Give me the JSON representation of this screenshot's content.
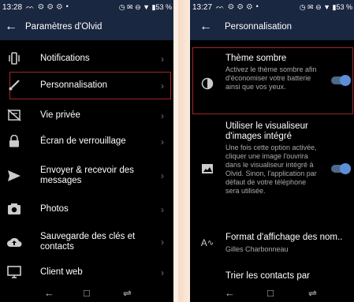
{
  "left_screen": {
    "status": {
      "time": "13:28",
      "left_icons": "ᨓ ⚙ ⚙ ⚙ •",
      "right_icons": "◷ ✉ ⊖ ▼ ▮53 %"
    },
    "appbar": {
      "back": "←",
      "title": "Paramètres d'Olvid"
    },
    "items": [
      {
        "label": "Notifications",
        "icon": "vibration-icon"
      },
      {
        "label": "Personnalisation",
        "icon": "brush-icon"
      },
      {
        "label": "Vie privée",
        "icon": "eye-off-icon"
      },
      {
        "label": "Écran de verrouillage",
        "icon": "lock-icon"
      },
      {
        "label": "Envoyer & recevoir des messages",
        "icon": "send-icon"
      },
      {
        "label": "Photos",
        "icon": "camera-icon"
      },
      {
        "label": "Sauvegarde des clés et contacts",
        "icon": "cloud-upload-icon"
      },
      {
        "label": "Client web",
        "icon": "monitor-icon"
      }
    ],
    "chevron": "›",
    "nav": {
      "back": "←",
      "home": "□",
      "recents": "⇌"
    }
  },
  "right_screen": {
    "status": {
      "time": "13:27",
      "left_icons": "ᨓ ⚙ ⚙ ⚙ •",
      "right_icons": "◷ ✉ ⊖ ▼ ▮53 %"
    },
    "appbar": {
      "back": "←",
      "title": "Personnalisation"
    },
    "settings": [
      {
        "title": "Thème sombre",
        "description": "Activez le thème sombre afin d'économiser votre batterie ainsi que vos yeux.",
        "toggle_on": true,
        "icon": "contrast-icon"
      },
      {
        "title": "Utiliser le visualiseur d'images intégré",
        "description": "Une fois cette option activée, cliquer une image l'ouvrira dans le visualiseur intégré à Olvid. Sinon, l'application par défaut de votre téléphone sera utilisée.",
        "toggle_on": true,
        "icon": "image-icon"
      },
      {
        "title": "Format d'affichage des nom..",
        "description": "Gilles Charbonneau",
        "icon": "text-format-icon"
      },
      {
        "title": "Trier les contacts par"
      }
    ],
    "nav": {
      "back": "←",
      "home": "□",
      "recents": "⇌"
    }
  },
  "colors": {
    "appbar": "#1a2740",
    "highlight": "#a32626",
    "toggle_knob": "#5d8fd9"
  }
}
